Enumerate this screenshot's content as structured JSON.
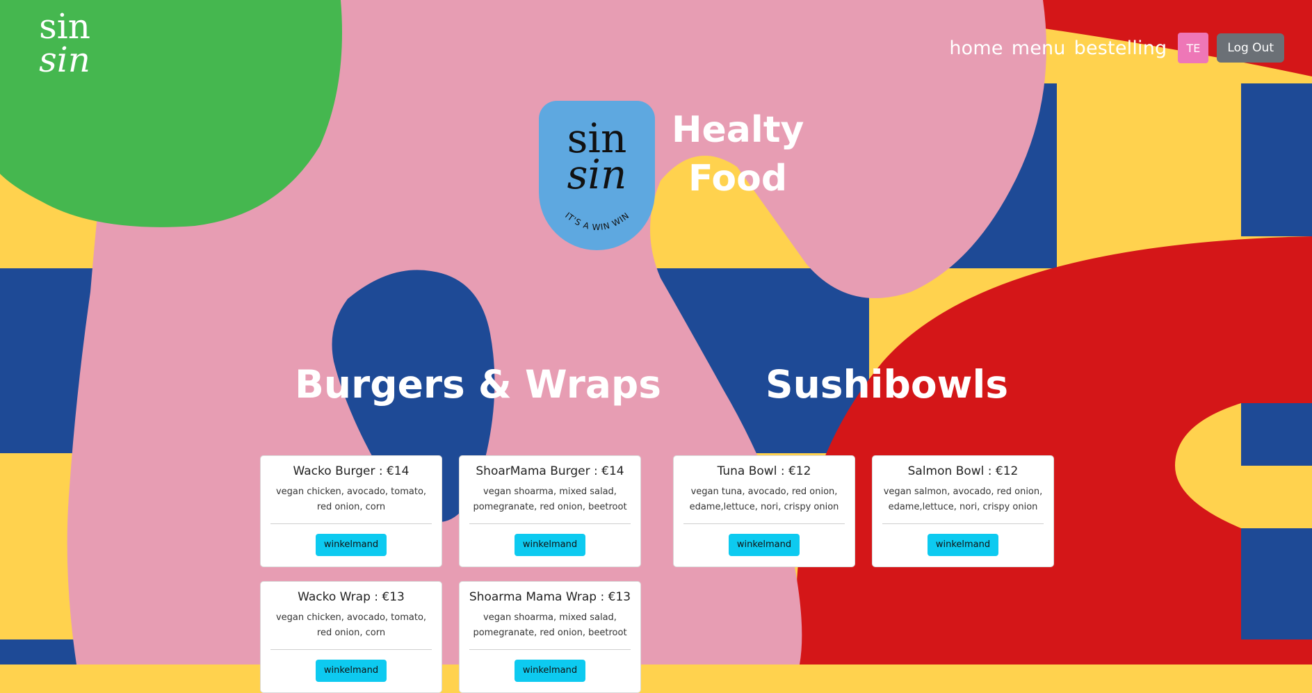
{
  "brand": {
    "line1": "sin",
    "line2": "sin"
  },
  "nav": {
    "home": "home",
    "menu": "menu",
    "order": "bestelling",
    "avatar": "TE",
    "logout": "Log Out"
  },
  "hero": {
    "badge_line1": "sin",
    "badge_line2": "sin",
    "badge_tagline": "IT'S A WIN WIN",
    "title_line1": "Healty",
    "title_line2": "Food"
  },
  "sections": {
    "burgers": "Burgers & Wraps",
    "sushi": "Sushibowls"
  },
  "cards": [
    {
      "name": "Wacko Burger : €14",
      "desc1": "vegan chicken, avocado, tomato,",
      "desc2": "red onion, corn",
      "button": "winkelmand"
    },
    {
      "name": "ShoarMama Burger : €14",
      "desc1": "vegan shoarma, mixed salad,",
      "desc2": "pomegranate, red onion, beetroot",
      "button": "winkelmand"
    },
    {
      "name": "Tuna Bowl : €12",
      "desc1": "vegan tuna, avocado, red onion,",
      "desc2": "edame,lettuce, nori, crispy onion",
      "button": "winkelmand"
    },
    {
      "name": "Salmon Bowl : €12",
      "desc1": "vegan salmon, avocado, red onion,",
      "desc2": "edame,lettuce, nori, crispy onion",
      "button": "winkelmand"
    },
    {
      "name": "Wacko Wrap : €13",
      "desc1": "vegan chicken, avocado, tomato,",
      "desc2": "red onion, corn",
      "button": "winkelmand"
    },
    {
      "name": "Shoarma Mama Wrap : €13",
      "desc1": "vegan shoarma, mixed salad,",
      "desc2": "pomegranate, red onion, beetroot",
      "button": "winkelmand"
    }
  ],
  "colors": {
    "green": "#45b74f",
    "pink": "#e79db3",
    "yellow": "#ffd24e",
    "blue": "#1e4a96",
    "red": "#d41618",
    "badge": "#5ea8e0",
    "button": "#0dcaf0"
  }
}
